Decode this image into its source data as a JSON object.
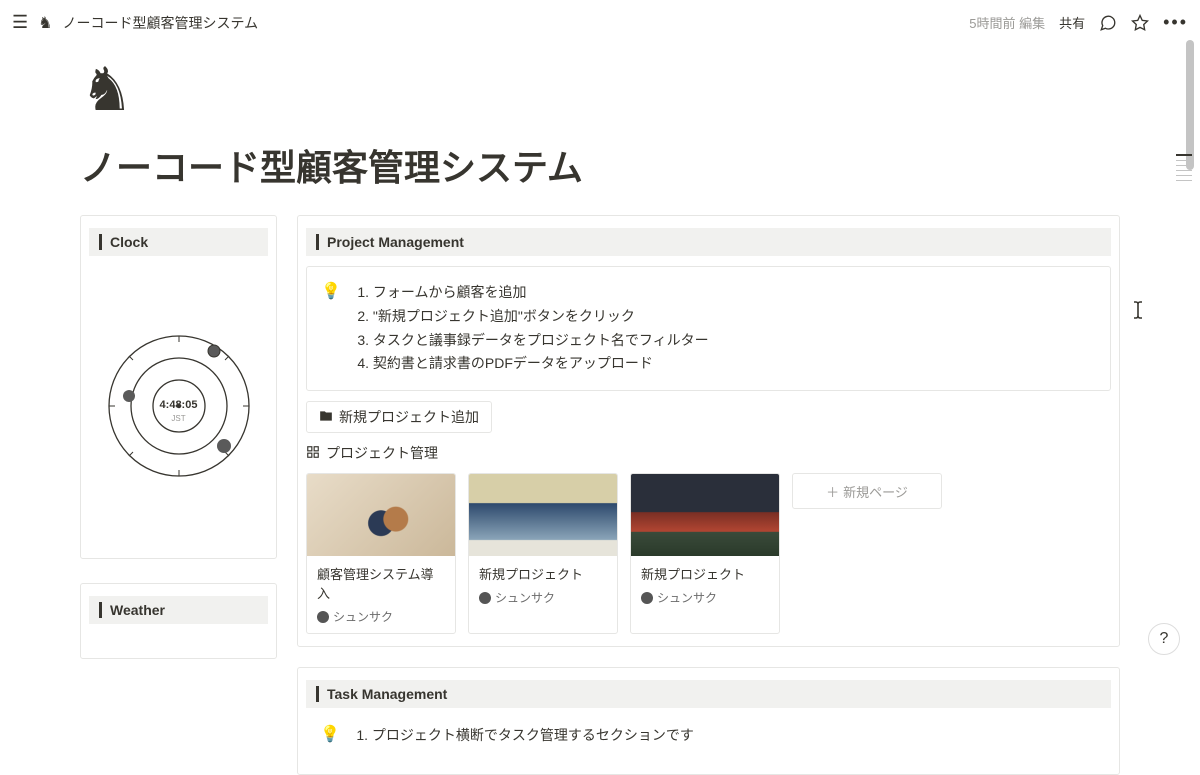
{
  "topbar": {
    "breadcrumb": "ノーコード型顧客管理システム",
    "timestamp": "5時間前 編集",
    "share_label": "共有"
  },
  "page": {
    "icon": "♞",
    "title": "ノーコード型顧客管理システム"
  },
  "sidebar": {
    "clock": {
      "header": "Clock",
      "time": "4:48:05",
      "tz": "JST"
    },
    "weather": {
      "header": "Weather"
    }
  },
  "project_mgmt": {
    "header": "Project Management",
    "steps": [
      "フォームから顧客を追加",
      "\"新規プロジェクト追加\"ボタンをクリック",
      "タスクと議事録データをプロジェクト名でフィルター",
      "契約書と請求書のPDFデータをアップロード"
    ],
    "add_button": "新規プロジェクト追加",
    "manage_link": "プロジェクト管理",
    "new_page_label": "新規ページ",
    "cards": [
      {
        "title": "顧客管理システム導入",
        "author": "シュンサク"
      },
      {
        "title": "新規プロジェクト",
        "author": "シュンサク"
      },
      {
        "title": "新規プロジェクト",
        "author": "シュンサク"
      }
    ]
  },
  "task_mgmt": {
    "header": "Task Management",
    "steps": [
      "プロジェクト横断でタスク管理するセクションです"
    ]
  }
}
